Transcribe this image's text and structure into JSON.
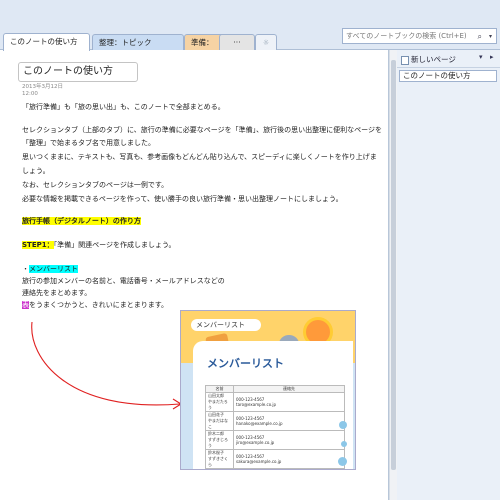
{
  "tabs": [
    {
      "label": "このノートの使い方"
    },
    {
      "label": "整理：トピック"
    },
    {
      "label": "準備：MEMO"
    },
    {
      "label": "···"
    },
    {
      "label": "☼"
    }
  ],
  "search": {
    "placeholder": "すべてのノートブックの検索 (Ctrl+E)"
  },
  "page": {
    "title": "このノートの使い方",
    "date": "2013年3月12日",
    "time": "12:00",
    "intro": "「旅行準備」も「旅の思い出」も、このノートで全部まとめる。",
    "para1_l1": "セレクションタブ（上部のタブ）に、旅行の準備に必要なページを「準備」、旅行後の思い出整理に便利なページを",
    "para1_l2": "「整理」で始まるタブ名で用意しました。",
    "para1_l3": "思いつくままに、テキストも、写真も、参考画像もどんどん貼り込んで、スピーディに楽しくノートを作り上げま",
    "para1_l4": "しょう。",
    "para2": "なお、セレクションタブのページは一例です。",
    "para3": "必要な情報を掲載できるページを作って、使い勝手の良い旅行準備・思い出整理ノートにしましょう。",
    "heading": "旅行手帳（デジタルノート）の作り方",
    "step1_label": "STEP1：",
    "step1_text": "「準備」関連ページを作成しましょう。",
    "bullet_prefix": "・",
    "member_link": "メンバーリスト",
    "member_desc1": "旅行の参加メンバーの名前と、電話番号・メールアドレスなどの",
    "member_desc2": "連絡先をまとめます。",
    "member_desc3_hl": "表",
    "member_desc3": "をうまくつかうと、きれいにまとまります。"
  },
  "member_image": {
    "label": "メンバーリスト",
    "heading": "メンバーリスト",
    "col_name": "名前",
    "col_contact": "連絡先",
    "rows": [
      {
        "name1": "山田太郎",
        "name2": "やまだたろう",
        "phone": "000-123-4567",
        "email": "taro@example.co.jp"
      },
      {
        "name1": "山田花子",
        "name2": "やまだはなこ",
        "phone": "000-123-4567",
        "email": "hanako@example.co.jp"
      },
      {
        "name1": "鈴木二郎",
        "name2": "すずきじろう",
        "phone": "000-123-4567",
        "email": "jiro@example.co.jp"
      },
      {
        "name1": "鈴木桜子",
        "name2": "すずきさくら",
        "phone": "000-123-4567",
        "email": "sakura@example.co.jp"
      }
    ]
  },
  "right_pane": {
    "new_page": "新しいページ",
    "pages": [
      "このノートの使い方"
    ]
  },
  "colors": {
    "highlight_yellow": "#ffff00",
    "highlight_cyan": "#00ffff",
    "arrow_red": "#e02020"
  }
}
